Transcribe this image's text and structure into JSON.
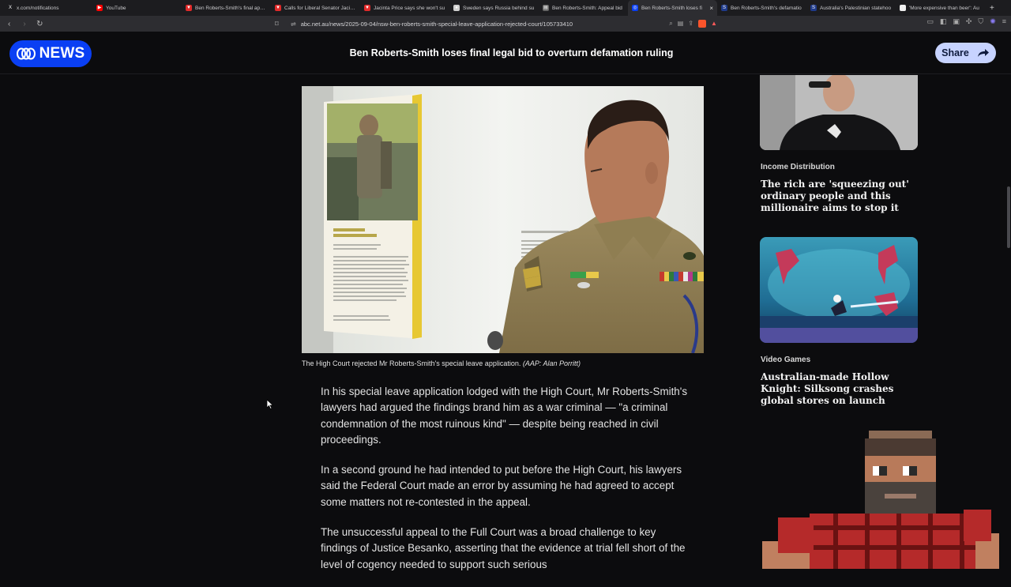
{
  "browser": {
    "tabs": [
      {
        "title": "x.com/notifications",
        "fav_color": "#1c1c1f",
        "fav_glyph": "X"
      },
      {
        "title": "YouTube",
        "fav_color": "#ff0000",
        "fav_glyph": "▶"
      },
      {
        "title": "Ben Roberts-Smith's final appeal",
        "fav_color": "#e02a2a",
        "fav_glyph": "▼"
      },
      {
        "title": "Calls for Liberal Senator Jacinta",
        "fav_color": "#e02a2a",
        "fav_glyph": "▼"
      },
      {
        "title": "Jacinta Price says she won't su",
        "fav_color": "#e02a2a",
        "fav_glyph": "▼"
      },
      {
        "title": "Sweden says Russia behind su",
        "fav_color": "#cfcfcf",
        "fav_glyph": "●"
      },
      {
        "title": "Ben Roberts-Smith: Appeal bid",
        "fav_color": "#666",
        "fav_glyph": "▤"
      },
      {
        "title": "Ben Roberts-Smith loses fi",
        "fav_color": "#0a3ff3",
        "fav_glyph": "◎",
        "active": true
      },
      {
        "title": "Ben Roberts-Smith's defamatio",
        "fav_color": "#1f3a8a",
        "fav_glyph": "S"
      },
      {
        "title": "Australia's Palestinian statehoo",
        "fav_color": "#1f3a8a",
        "fav_glyph": "S"
      },
      {
        "title": "'More expensive than beer': Au",
        "fav_color": "#eee",
        "fav_glyph": "◻"
      }
    ],
    "url": "abc.net.au/news/2025-09-04/nsw-ben-roberts-smith-special-leave-application-rejected-court/105733410"
  },
  "header": {
    "logo_text": "NEWS",
    "title": "Ben Roberts-Smith loses final legal bid to overturn defamation ruling",
    "share_label": "Share"
  },
  "photo": {
    "caption": "The High Court rejected Mr Roberts-Smith's special leave application.",
    "credit": "(AAP: Alan Porritt)"
  },
  "article": {
    "paragraphs": [
      "In his special leave application lodged with the High Court, Mr Roberts-Smith's lawyers had argued the findings brand him as a war criminal — \"a criminal condemnation of the most ruinous kind\" — despite being reached in civil proceedings.",
      "In a second ground he had intended to put before the High Court, his lawyers said the Federal Court made an error by assuming he had agreed to accept some matters not re-contested in the appeal.",
      "The unsuccessful appeal to the Full Court was a broad challenge to key findings of Justice Besanko, asserting that the evidence at trial fell short of the level of cogency needed to support such serious"
    ]
  },
  "sidebar": {
    "items": [
      {
        "category": "Income Distribution",
        "headline": "The rich are 'squeezing out' ordinary people and this millionaire aims to stop it"
      },
      {
        "category": "Video Games",
        "headline": "Australian-made Hollow Knight: Silksong crashes global stores on launch"
      }
    ]
  }
}
